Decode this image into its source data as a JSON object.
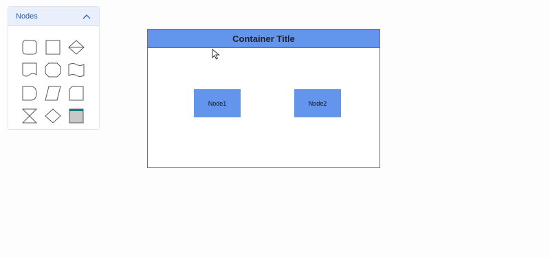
{
  "palette": {
    "title": "Nodes",
    "shapes": [
      {
        "name": "terminator-icon"
      },
      {
        "name": "rectangle-icon"
      },
      {
        "name": "sort-icon"
      },
      {
        "name": "document-icon"
      },
      {
        "name": "preparation-icon"
      },
      {
        "name": "tape-icon"
      },
      {
        "name": "delay-icon"
      },
      {
        "name": "data-parallelogram-icon"
      },
      {
        "name": "card-icon"
      },
      {
        "name": "collate-icon"
      },
      {
        "name": "decision-diamond-icon"
      },
      {
        "name": "container-icon"
      }
    ]
  },
  "diagram": {
    "container": {
      "title": "Container Title",
      "header_color": "#6495ED",
      "border_color": "#6E6E6E"
    },
    "nodes": [
      {
        "label": "Node1",
        "fill": "#6495ED"
      },
      {
        "label": "Node2",
        "fill": "#6495ED"
      }
    ]
  },
  "colors": {
    "accent": "#1F5FB4",
    "palette_header_bg": "#E9F0FB",
    "shape_stroke": "#555555",
    "container_shape_bar": "#127F7F"
  }
}
